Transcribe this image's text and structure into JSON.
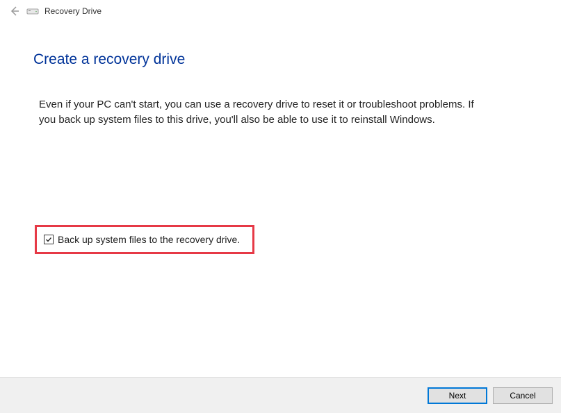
{
  "titlebar": {
    "title": "Recovery Drive"
  },
  "heading": "Create a recovery drive",
  "description": "Even if your PC can't start, you can use a recovery drive to reset it or troubleshoot problems. If you back up system files to this drive, you'll also be able to use it to reinstall Windows.",
  "checkbox": {
    "label": "Back up system files to the recovery drive.",
    "checked": true
  },
  "buttons": {
    "next": "Next",
    "cancel": "Cancel"
  }
}
